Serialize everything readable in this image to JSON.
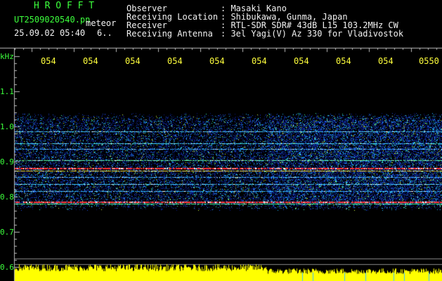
{
  "header": {
    "brand": "H R O F F T",
    "filename": "UT2509020540.pn",
    "mode": "meteor",
    "datetime": "25.09.02 05:40",
    "scale": "6..",
    "fields": [
      {
        "label": "Observer",
        "value": ": Masaki Kano"
      },
      {
        "label": "Receiving Location",
        "value": ": Shibukawa, Gunma, Japan"
      },
      {
        "label": "Receiver",
        "value": ": RTL-SDR SDR# 43dB L15 103.2MHz CW"
      },
      {
        "label": "Receiving Antenna",
        "value": ": 3el Yagi(V) Az 330 for Vladivostok"
      }
    ]
  },
  "time_axis": {
    "ticks": [
      "054",
      "054",
      "054",
      "054",
      "054",
      "054",
      "054",
      "054",
      "054",
      "0550"
    ]
  },
  "freq_axis": {
    "unit": "kHz",
    "labels": [
      "1.1",
      "1.0",
      "0.9",
      "0.8",
      "0.7",
      "0.6"
    ]
  },
  "colors": {
    "header_green": "#3cff3c",
    "header_white": "#f2f2f2",
    "tick_yellow": "#ffff3c",
    "noise_blue": "#1030c0",
    "carrier_red": "#ff2020",
    "level_yellow": "#ffff00"
  }
}
